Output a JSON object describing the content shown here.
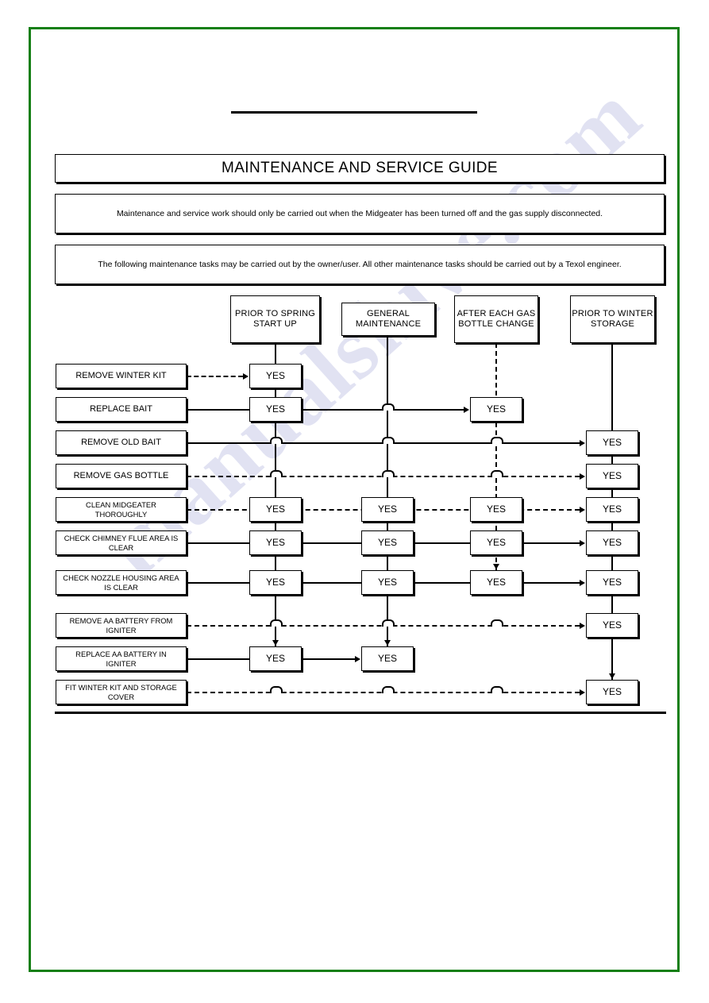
{
  "page": {
    "border_color": "#157f15",
    "watermark": "manualshive.com"
  },
  "title": "MAINTENANCE AND SERVICE GUIDE",
  "notices": [
    "Maintenance and service work should only be carried out when the Midgeater has been turned off and the gas supply disconnected.",
    "The following maintenance tasks may be carried out by the owner/user. All other maintenance tasks should be carried out by a Texol engineer."
  ],
  "columns": [
    {
      "label": "PRIOR TO SPRING START UP"
    },
    {
      "label": "GENERAL MAINTENANCE"
    },
    {
      "label": "AFTER EACH GAS BOTTLE CHANGE"
    },
    {
      "label": "PRIOR TO WINTER STORAGE"
    }
  ],
  "yes_label": "YES",
  "tasks": [
    {
      "label": "REMOVE WINTER KIT",
      "marks": [
        true,
        false,
        false,
        false
      ]
    },
    {
      "label": "REPLACE BAIT",
      "marks": [
        true,
        false,
        true,
        false
      ]
    },
    {
      "label": "REMOVE OLD BAIT",
      "marks": [
        false,
        false,
        false,
        true
      ]
    },
    {
      "label": "REMOVE GAS BOTTLE",
      "marks": [
        false,
        false,
        false,
        true
      ]
    },
    {
      "label": "CLEAN MIDGEATER THOROUGHLY",
      "marks": [
        true,
        true,
        true,
        true
      ]
    },
    {
      "label": "CHECK CHIMNEY FLUE AREA IS CLEAR",
      "marks": [
        true,
        true,
        true,
        true
      ]
    },
    {
      "label": "CHECK NOZZLE HOUSING AREA IS CLEAR",
      "marks": [
        true,
        true,
        true,
        true
      ]
    },
    {
      "label": "REMOVE AA BATTERY FROM IGNITER",
      "marks": [
        false,
        false,
        false,
        true
      ]
    },
    {
      "label": "REPLACE AA BATTERY IN IGNITER",
      "marks": [
        true,
        true,
        false,
        false
      ]
    },
    {
      "label": "FIT WINTER KIT AND STORAGE COVER",
      "marks": [
        false,
        false,
        false,
        true
      ]
    }
  ]
}
